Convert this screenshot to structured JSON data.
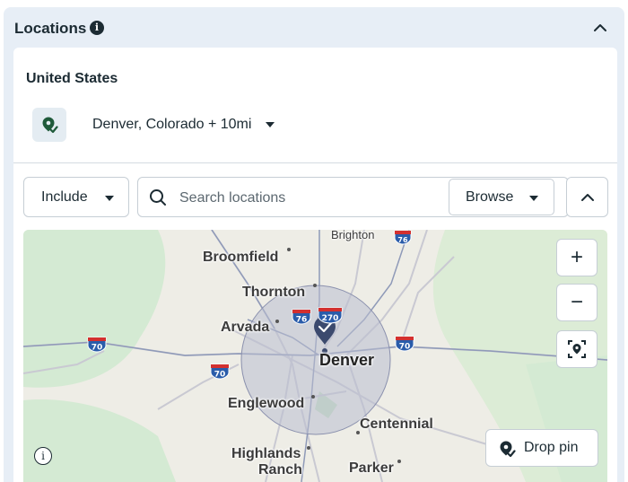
{
  "section": {
    "title": "Locations",
    "info_icon": "info-icon",
    "collapse_icon": "chevron-up-icon"
  },
  "location": {
    "country": "United States",
    "selected": "Denver, Colorado + 10mi",
    "icon": "location-pin-check-icon"
  },
  "toolbar": {
    "include_label": "Include",
    "search_placeholder": "Search locations",
    "search_value": "",
    "browse_label": "Browse"
  },
  "map": {
    "zoom_in": "+",
    "zoom_out": "−",
    "drop_pin_label": "Drop pin",
    "info_glyph": "i",
    "cities": {
      "brighton": "Brighton",
      "broomfield": "Broomfield",
      "thornton": "Thornton",
      "arvada": "Arvada",
      "denver": "Denver",
      "englewood": "Englewood",
      "centennial": "Centennial",
      "highlands": "Highlands",
      "ranch": "Ranch",
      "parker": "Parker"
    },
    "shields": {
      "i76_a": "76",
      "i76_b": "76",
      "i270": "270",
      "i70_a": "70",
      "i70_b": "70",
      "i70_c": "70"
    }
  },
  "colors": {
    "panel_bg": "#e7eef6",
    "text": "#1c2b33",
    "radius_fill": "#b9bdd0",
    "pin": "#3c4a6e",
    "interstate_blue": "#2a5caa",
    "interstate_red": "#d3302f"
  }
}
